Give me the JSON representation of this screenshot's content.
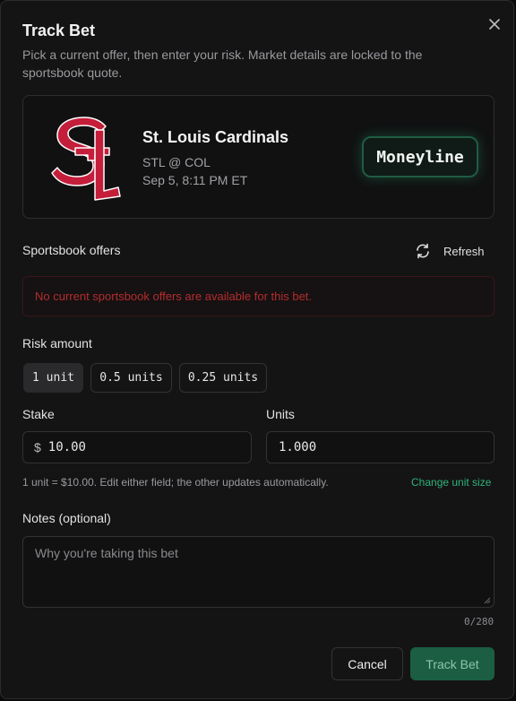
{
  "modal": {
    "title": "Track Bet",
    "subtitle": "Pick a current offer, then enter your risk. Market details are locked to the sportsbook quote.",
    "close_icon": "close-icon"
  },
  "bet": {
    "team_name": "St. Louis Cardinals",
    "matchup": "STL @ COL",
    "datetime": "Sep 5, 8:11 PM ET",
    "market": "Moneyline",
    "logo_icon": "cardinals-stl-logo",
    "logo_color": "#c41e3a"
  },
  "offers": {
    "label": "Sportsbook offers",
    "refresh_label": "Refresh",
    "refresh_icon": "refresh-icon",
    "empty_message": "No current sportsbook offers are available for this bet.",
    "error_color": "#b32d2e"
  },
  "risk": {
    "label": "Risk amount",
    "options": [
      "1 unit",
      "0.5 units",
      "0.25 units"
    ],
    "selected": "1 unit"
  },
  "stake": {
    "label": "Stake",
    "prefix": "$",
    "value": "10.00"
  },
  "units": {
    "label": "Units",
    "value": "1.000"
  },
  "hint": {
    "text": "1 unit = $10.00. Edit either field; the other updates automatically.",
    "change_link": "Change unit size"
  },
  "notes": {
    "label": "Notes (optional)",
    "placeholder": "Why you're taking this bet",
    "counter": "0/280"
  },
  "actions": {
    "cancel": "Cancel",
    "submit": "Track Bet"
  },
  "colors": {
    "accent": "#2fb37a",
    "primary_button": "#1b5e43"
  }
}
